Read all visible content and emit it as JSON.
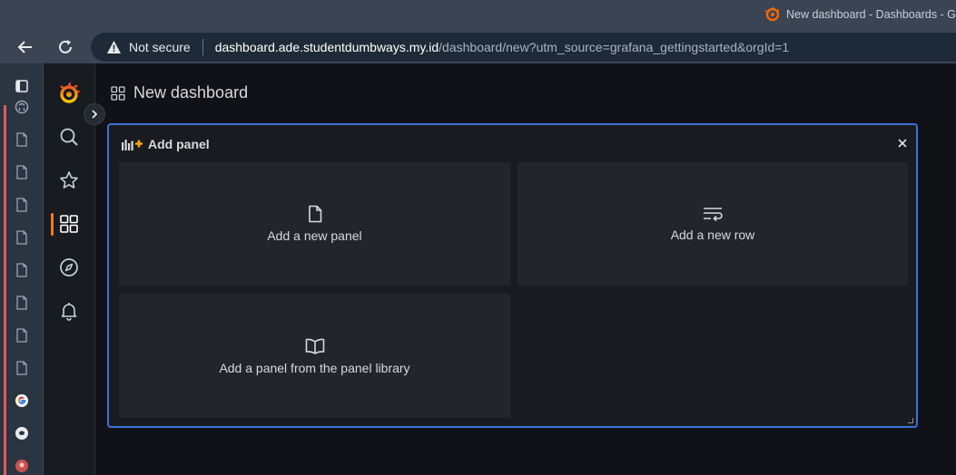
{
  "browser": {
    "tab_title": "New dashboard - Dashboards - Gra",
    "security_label": "Not secure",
    "url_host": "dashboard.ade.studentdumbways.my.id",
    "url_path": "/dashboard/new?utm_source=grafana_gettingstarted&orgId=1"
  },
  "browser_sidebar": {
    "items": [
      {
        "icon": "github-icon"
      },
      {
        "icon": "page-icon"
      },
      {
        "icon": "page-icon"
      },
      {
        "icon": "page-icon"
      },
      {
        "icon": "page-icon"
      },
      {
        "icon": "page-icon"
      },
      {
        "icon": "page-icon"
      },
      {
        "icon": "page-icon"
      },
      {
        "icon": "page-icon"
      },
      {
        "icon": "google-icon"
      },
      {
        "icon": "github-icon"
      },
      {
        "icon": "app-icon"
      }
    ]
  },
  "grafana_nav": {
    "items": [
      "grafana-logo",
      "search-icon",
      "starred-icon",
      "dashboards-icon",
      "explore-icon",
      "alerting-icon"
    ],
    "active": "dashboards-icon",
    "accent_color": "#ff7a1a"
  },
  "page": {
    "title": "New dashboard"
  },
  "add_panel": {
    "title": "Add panel",
    "options": [
      {
        "label": "Add a new panel",
        "icon": "file-icon"
      },
      {
        "label": "Add a new row",
        "icon": "row-icon"
      },
      {
        "label": "Add a panel from the panel library",
        "icon": "book-icon"
      }
    ],
    "border_color": "#3d71d9"
  }
}
